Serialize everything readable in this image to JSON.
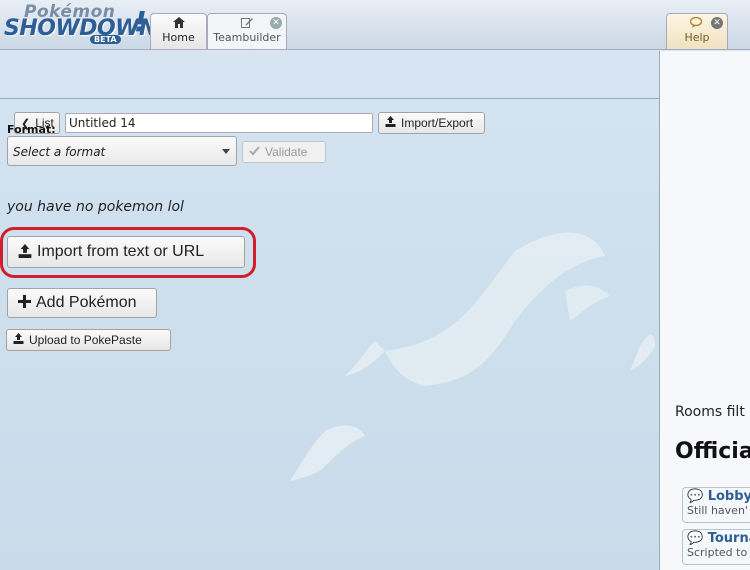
{
  "header": {
    "logo": {
      "top": "Pokémon",
      "main": "SHOWDOWN",
      "badge": "BETA",
      "mark": "!"
    },
    "tabs": [
      {
        "label": "Home",
        "icon": "home-icon"
      },
      {
        "label": "Teambuilder",
        "icon": "edit-icon"
      }
    ],
    "help": {
      "label": "Help",
      "icon": "chat-icon"
    }
  },
  "toolbar": {
    "list_label": "List",
    "team_name": "Untitled 14",
    "import_export_label": "Import/Export"
  },
  "format": {
    "label": "Format:",
    "selected": "Select a format",
    "validate_label": "Validate"
  },
  "empty_message": "you have no pokemon lol",
  "actions": {
    "import_text_label": "Import from text or URL",
    "add_pokemon_label": "Add Pokémon",
    "upload_label": "Upload to PokePaste"
  },
  "right_panel": {
    "rooms_filter": "Rooms filt",
    "official_heading": "Officia",
    "rooms": [
      {
        "name": "Lobby",
        "desc": "Still haven'"
      },
      {
        "name": "Tourna",
        "desc": "Scripted to"
      }
    ]
  },
  "colors": {
    "highlight": "#d21f2b",
    "logo_blue": "#2d5e95"
  }
}
